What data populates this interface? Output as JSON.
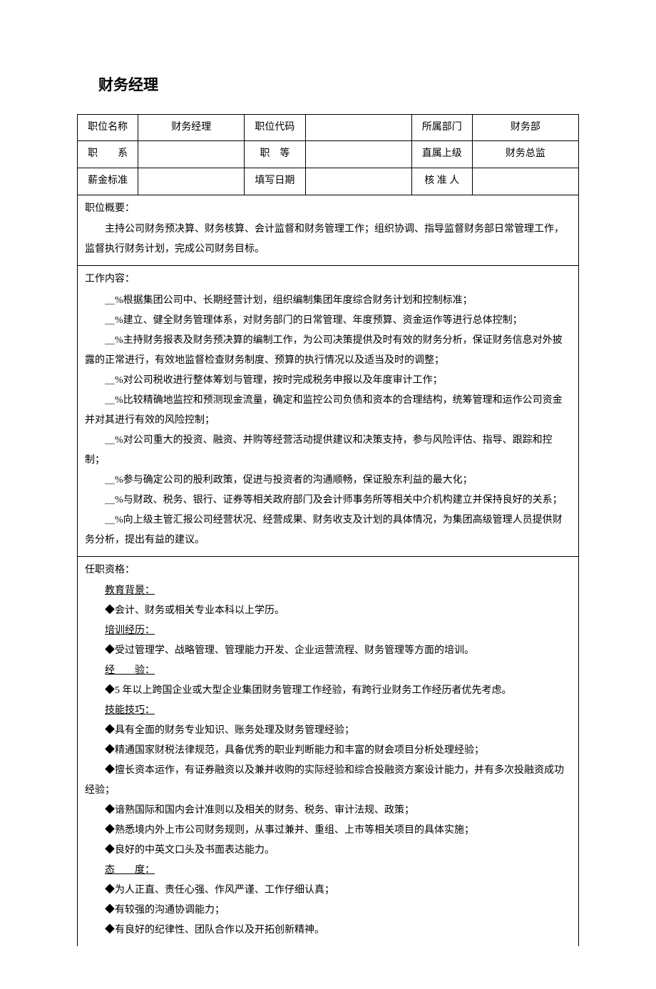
{
  "title": "财务经理",
  "header": {
    "r1c1_label": "职位名称",
    "r1c1_value": "财务经理",
    "r1c2_label": "职位代码",
    "r1c2_value": "",
    "r1c3_label": "所属部门",
    "r1c3_value": "财务部",
    "r2c1_label": "职　　系",
    "r2c1_value": "",
    "r2c2_label": "职　等",
    "r2c2_value": "",
    "r2c3_label": "直属上级",
    "r2c3_value": "财务总监",
    "r3c1_label": "薪金标准",
    "r3c1_value": "",
    "r3c2_label": "填写日期",
    "r3c2_value": "",
    "r3c3_label": "核 准 人",
    "r3c3_value": ""
  },
  "overview": {
    "heading": "职位概要：",
    "text": "主持公司财务预决算、财务核算、会计监督和财务管理工作；组织协调、指导监督财务部日常管理工作，监督执行财务计划，完成公司财务目标。"
  },
  "content": {
    "heading": "工作内容：",
    "items": [
      "＿%根据集团公司中、长期经营计划，组织编制集团年度综合财务计划和控制标准；",
      "＿%建立、健全财务管理体系，对财务部门的日常管理、年度预算、资金运作等进行总体控制；",
      "＿%主持财务报表及财务预决算的编制工作，为公司决策提供及时有效的财务分析，保证财务信息对外披露的正常进行，有效地监督检查财务制度、预算的执行情况以及适当及时的调整；",
      "＿%对公司税收进行整体筹划与管理，按时完成税务申报以及年度审计工作；",
      "＿%比较精确地监控和预测现金流量，确定和监控公司负债和资本的合理结构，统筹管理和运作公司资金并对其进行有效的风险控制；",
      "＿%对公司重大的投资、融资、并购等经营活动提供建议和决策支持，参与风险评估、指导、跟踪和控制；",
      "＿%参与确定公司的股利政策，促进与投资者的沟通顺畅，保证股东利益的最大化；",
      "＿%与财政、税务、银行、证券等相关政府部门及会计师事务所等相关中介机构建立并保持良好的关系；",
      "＿%向上级主管汇报公司经营状况、经营成果、财务收支及计划的具体情况，为集团高级管理人员提供财务分析，提出有益的建议。"
    ]
  },
  "qualifications": {
    "heading": "任职资格：",
    "education_heading": "教育背景：",
    "education_item": "◆会计、财务或相关专业本科以上学历。",
    "training_heading": "培训经历：",
    "training_item": "◆受过管理学、战略管理、管理能力开发、企业运营流程、财务管理等方面的培训。",
    "experience_heading": "经　　验：",
    "experience_item": "◆5 年以上跨国企业或大型企业集团财务管理工作经验，有跨行业财务工作经历者优先考虑。",
    "skills_heading": "技能技巧：",
    "skills_items": [
      "◆具有全面的财务专业知识、账务处理及财务管理经验；",
      "◆精通国家财税法律规范，具备优秀的职业判断能力和丰富的财会项目分析处理经验；",
      "◆擅长资本运作，有证券融资以及兼并收购的实际经验和综合投融资方案设计能力，并有多次投融资成功经验；",
      "◆谙熟国际和国内会计准则以及相关的财务、税务、审计法规、政策；",
      "◆熟悉境内外上市公司财务规则，从事过兼并、重组、上市等相关项目的具体实施；",
      "◆良好的中英文口头及书面表达能力。"
    ],
    "attitude_heading": "态　　度：",
    "attitude_items": [
      "◆为人正直、责任心强、作风严谨、工作仔细认真；",
      "◆有较强的沟通协调能力；",
      "◆有良好的纪律性、团队合作以及开拓创新精神。"
    ]
  }
}
